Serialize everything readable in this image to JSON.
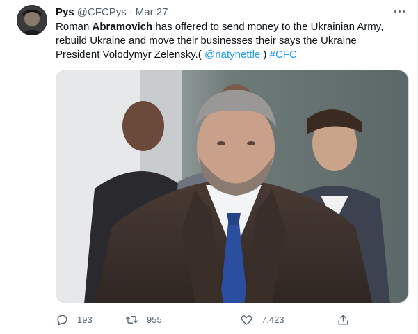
{
  "tweet": {
    "author_name": "Pys",
    "handle": "@CFCPys",
    "separator": "·",
    "date": "Mar 27",
    "text_part1": "Roman ",
    "text_bold": "Abramovich",
    "text_part2": " has offered to send money to the Ukrainian Army, rebuild Ukraine and move their businesses their says the Ukraine President Volodymyr Zelensky.( ",
    "mention": "@natynettle",
    "text_part3": " ) ",
    "hashtag": "#CFC"
  },
  "actions": {
    "reply_count": "193",
    "retweet_count": "955",
    "like_count": "7,423"
  },
  "colors": {
    "link": "#1d9bf0",
    "secondary_text": "#536471",
    "primary_text": "#0f1419"
  },
  "icons": [
    "more-icon",
    "reply-icon",
    "retweet-icon",
    "like-icon",
    "share-icon"
  ]
}
